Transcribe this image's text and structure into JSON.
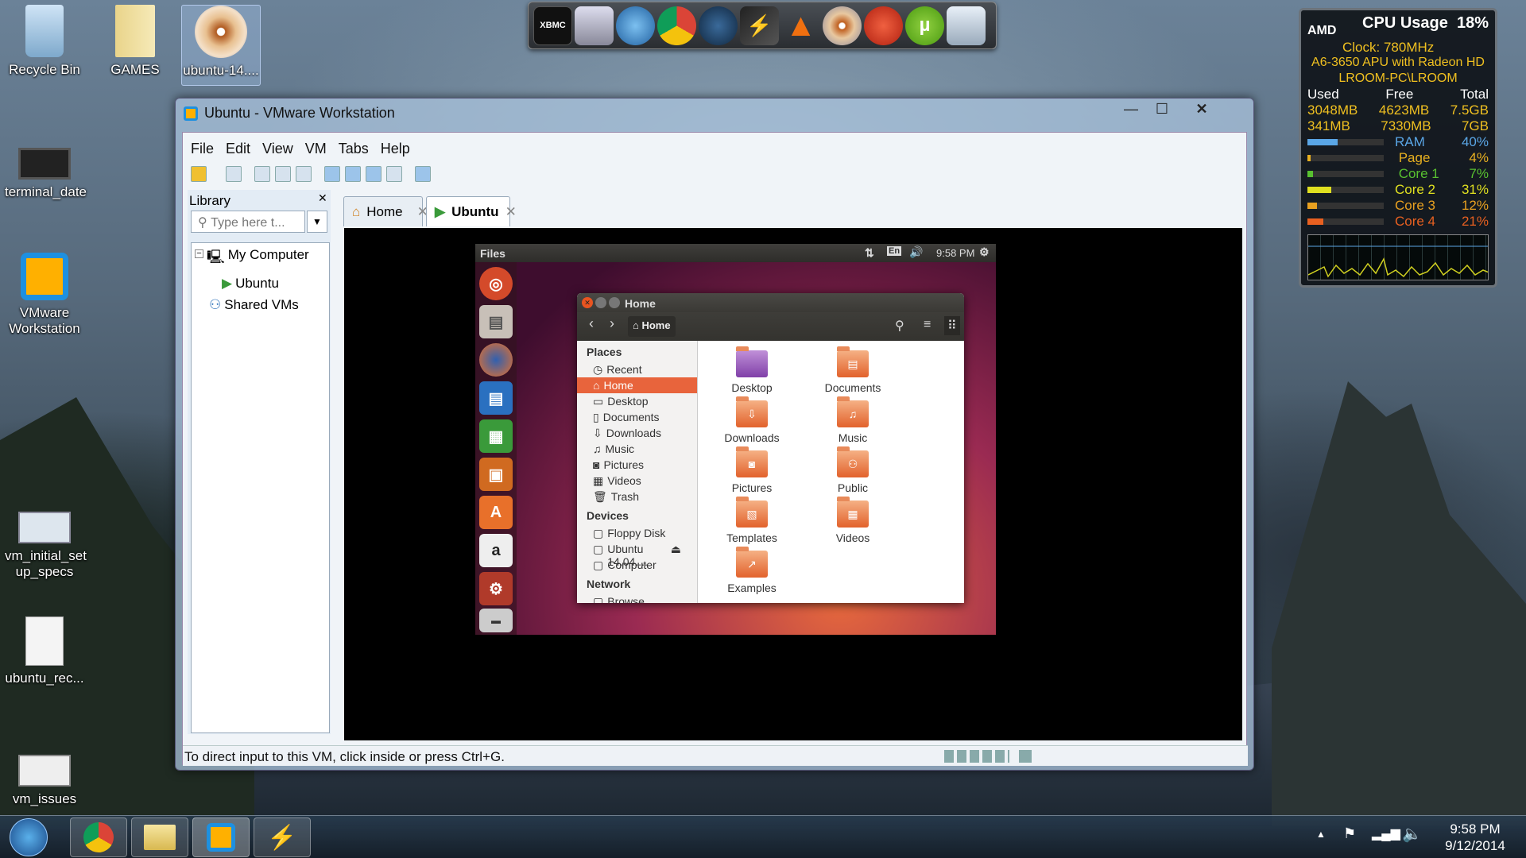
{
  "desktop_icons": [
    {
      "label": "Recycle Bin"
    },
    {
      "label": "GAMES"
    },
    {
      "label": "ubuntu-14...."
    },
    {
      "label": "terminal_date"
    },
    {
      "label": "VMware Workstation"
    },
    {
      "label": "vm_initial_set up_specs"
    },
    {
      "label": "ubuntu_rec..."
    },
    {
      "label": "vm_issues"
    }
  ],
  "dock": {
    "xbmc_label": "XBMC"
  },
  "gadget": {
    "title": "CPU Usage",
    "cpu_percent": "18%",
    "brand": "AMD",
    "clock": "Clock:  780MHz",
    "cpu_name": "A6-3650 APU with Radeon HD",
    "computer": "LROOM-PC\\LROOM",
    "headers": [
      "Used",
      "Free",
      "Total"
    ],
    "mem_rows": [
      [
        "3048MB",
        "4623MB",
        "7.5GB"
      ],
      [
        "341MB",
        "7330MB",
        "7GB"
      ]
    ],
    "meters": [
      {
        "label": "RAM",
        "value": "40%",
        "level": 0.4,
        "color": "#5aa6e6"
      },
      {
        "label": "Page",
        "value": "4%",
        "level": 0.04,
        "color": "#e8b020"
      },
      {
        "label": "Core 1",
        "value": "7%",
        "level": 0.07,
        "color": "#58c030"
      },
      {
        "label": "Core 2",
        "value": "31%",
        "level": 0.31,
        "color": "#e0e020"
      },
      {
        "label": "Core 3",
        "value": "12%",
        "level": 0.12,
        "color": "#e8a020"
      },
      {
        "label": "Core 4",
        "value": "21%",
        "level": 0.21,
        "color": "#e86020"
      }
    ]
  },
  "vmware": {
    "title": "Ubuntu - VMware Workstation",
    "menu": [
      "File",
      "Edit",
      "View",
      "VM",
      "Tabs",
      "Help"
    ],
    "library_title": "Library",
    "search_placeholder": "Type here t...",
    "tree": [
      "My Computer",
      "Ubuntu",
      "Shared VMs"
    ],
    "tabs": [
      "Home",
      "Ubuntu"
    ],
    "status": "To direct input to this VM, click inside or press Ctrl+G."
  },
  "ubuntu": {
    "panel_title": "Files",
    "lang": "En",
    "time": "9:58 PM",
    "fm_title": "Home",
    "path": "Home",
    "places_header": "Places",
    "places": [
      "Recent",
      "Home",
      "Desktop",
      "Documents",
      "Downloads",
      "Music",
      "Pictures",
      "Videos",
      "Trash"
    ],
    "devices_header": "Devices",
    "devices": [
      "Floppy Disk",
      "Ubuntu 14.04....",
      "Computer"
    ],
    "network_header": "Network",
    "network": [
      "Browse Network"
    ],
    "files": [
      "Desktop",
      "Documents",
      "Downloads",
      "Music",
      "Pictures",
      "Public",
      "Templates",
      "Videos",
      "Examples"
    ]
  },
  "clock": {
    "time": "9:58 PM",
    "date": "9/12/2014"
  }
}
